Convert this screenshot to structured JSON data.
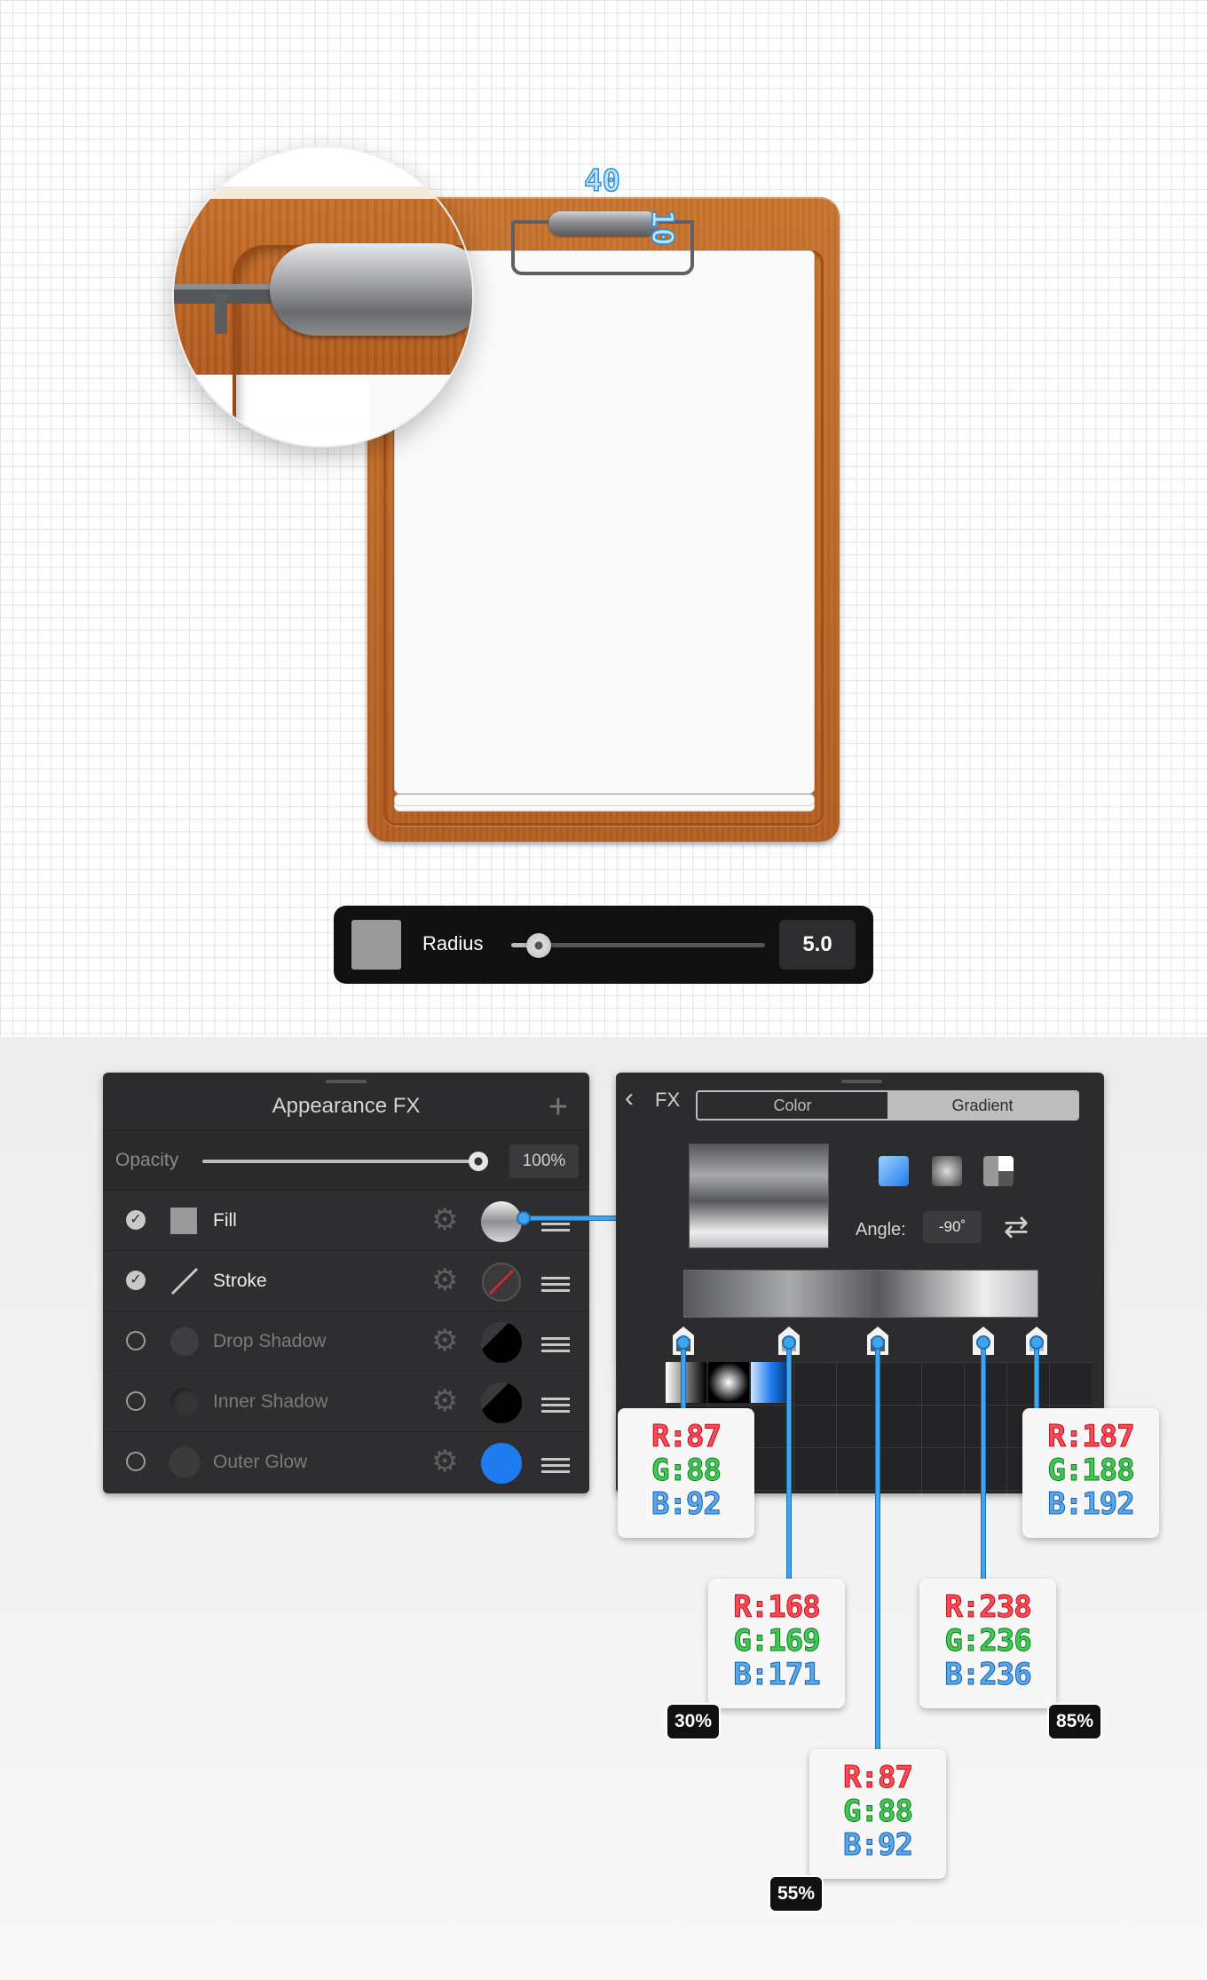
{
  "canvas": {
    "dimensions": {
      "width_label": "40",
      "height_label": "10"
    }
  },
  "radius_control": {
    "label": "Radius",
    "value": "5.0",
    "slider_fraction": 0.11,
    "swatch_color": "#9a9a9a"
  },
  "appearance_panel": {
    "title": "Appearance FX",
    "add_icon": "plus-icon",
    "opacity": {
      "label": "Opacity",
      "value": "100%",
      "fraction": 1.0
    },
    "effects": [
      {
        "label": "Fill",
        "enabled": true
      },
      {
        "label": "Stroke",
        "enabled": true
      },
      {
        "label": "Drop Shadow",
        "enabled": false
      },
      {
        "label": "Inner Shadow",
        "enabled": false
      },
      {
        "label": "Outer Glow",
        "enabled": false
      }
    ]
  },
  "gradient_panel": {
    "back_label": "FX",
    "tabs": {
      "color": "Color",
      "gradient": "Gradient"
    },
    "selected_tab": "Gradient",
    "angle_label": "Angle:",
    "angle_value": "-90˚",
    "gradient_types": [
      "linear",
      "radial",
      "conical"
    ],
    "stops": [
      {
        "position": 0.0,
        "color": "#57585c"
      },
      {
        "position": 0.3,
        "color": "#a8a9ab"
      },
      {
        "position": 0.55,
        "color": "#57585c"
      },
      {
        "position": 0.85,
        "color": "#eeecec"
      },
      {
        "position": 1.0,
        "color": "#bbbcc0"
      }
    ]
  },
  "color_callouts": [
    {
      "r": "R:87",
      "g": "G:88",
      "b": "B:92"
    },
    {
      "r": "R:168",
      "g": "G:169",
      "b": "B:171",
      "pct": "30%"
    },
    {
      "r": "R:87",
      "g": "G:88",
      "b": "B:92",
      "pct": "55%"
    },
    {
      "r": "R:238",
      "g": "G:236",
      "b": "B:236",
      "pct": "85%"
    },
    {
      "r": "R:187",
      "g": "G:188",
      "b": "B:192"
    }
  ],
  "colors": {
    "accent_blue": "#3da5ef",
    "wood": "#c8742f",
    "panel_bg": "#2c2c2e",
    "outer_glow_swatch": "#1e7bf0"
  }
}
